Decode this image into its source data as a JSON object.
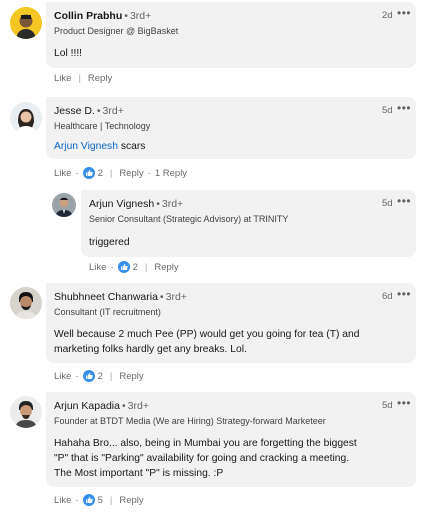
{
  "comments": [
    {
      "name": "Collin Prabhu",
      "degree": "3rd+",
      "headline": "Product Designer @ BigBasket",
      "time": "2d",
      "more": "•••",
      "body": "Lol !!!!",
      "actions": {
        "like": "Like",
        "reply": "Reply"
      }
    },
    {
      "name": "Jesse D.",
      "degree": "3rd+",
      "headline": "Healthcare | Technology",
      "time": "5d",
      "more": "•••",
      "mention": "Arjun Vignesh",
      "body": "scars",
      "actions": {
        "like": "Like",
        "reactions": "2",
        "reply": "Reply",
        "replies": "1 Reply"
      }
    },
    {
      "name": "Arjun Vignesh",
      "degree": "3rd+",
      "headline": "Senior Consultant (Strategic Advisory) at TRINITY",
      "time": "5d",
      "more": "•••",
      "body": "triggered",
      "actions": {
        "like": "Like",
        "reactions": "2",
        "reply": "Reply"
      }
    },
    {
      "name": "Shubhneet Chanwaria",
      "degree": "3rd+",
      "headline": "Consultant (IT recruitment)",
      "time": "6d",
      "more": "•••",
      "body_lines": [
        "Well because 2 much Pee (PP) would get you going for tea (T) and",
        "marketing folks hardly get any breaks. Lol."
      ],
      "actions": {
        "like": "Like",
        "reactions": "2",
        "reply": "Reply"
      }
    },
    {
      "name": "Arjun Kapadia",
      "degree": "3rd+",
      "headline": "Founder at BTDT Media (We are Hiring) Strategy-forward Marketeer",
      "time": "5d",
      "more": "•••",
      "body_lines": [
        "Hahaha Bro... also, being in Mumbai you are forgetting the biggest",
        "\"P\" that is \"Parking\" availability for going and cracking a meeting.",
        "The Most important \"P\" is missing. :P"
      ],
      "actions": {
        "like": "Like",
        "reactions": "5",
        "reply": "Reply"
      }
    }
  ],
  "colors": {
    "bubble": "#f2f2f2",
    "link": "#0a66c2",
    "like_icon": "#378fe9"
  }
}
